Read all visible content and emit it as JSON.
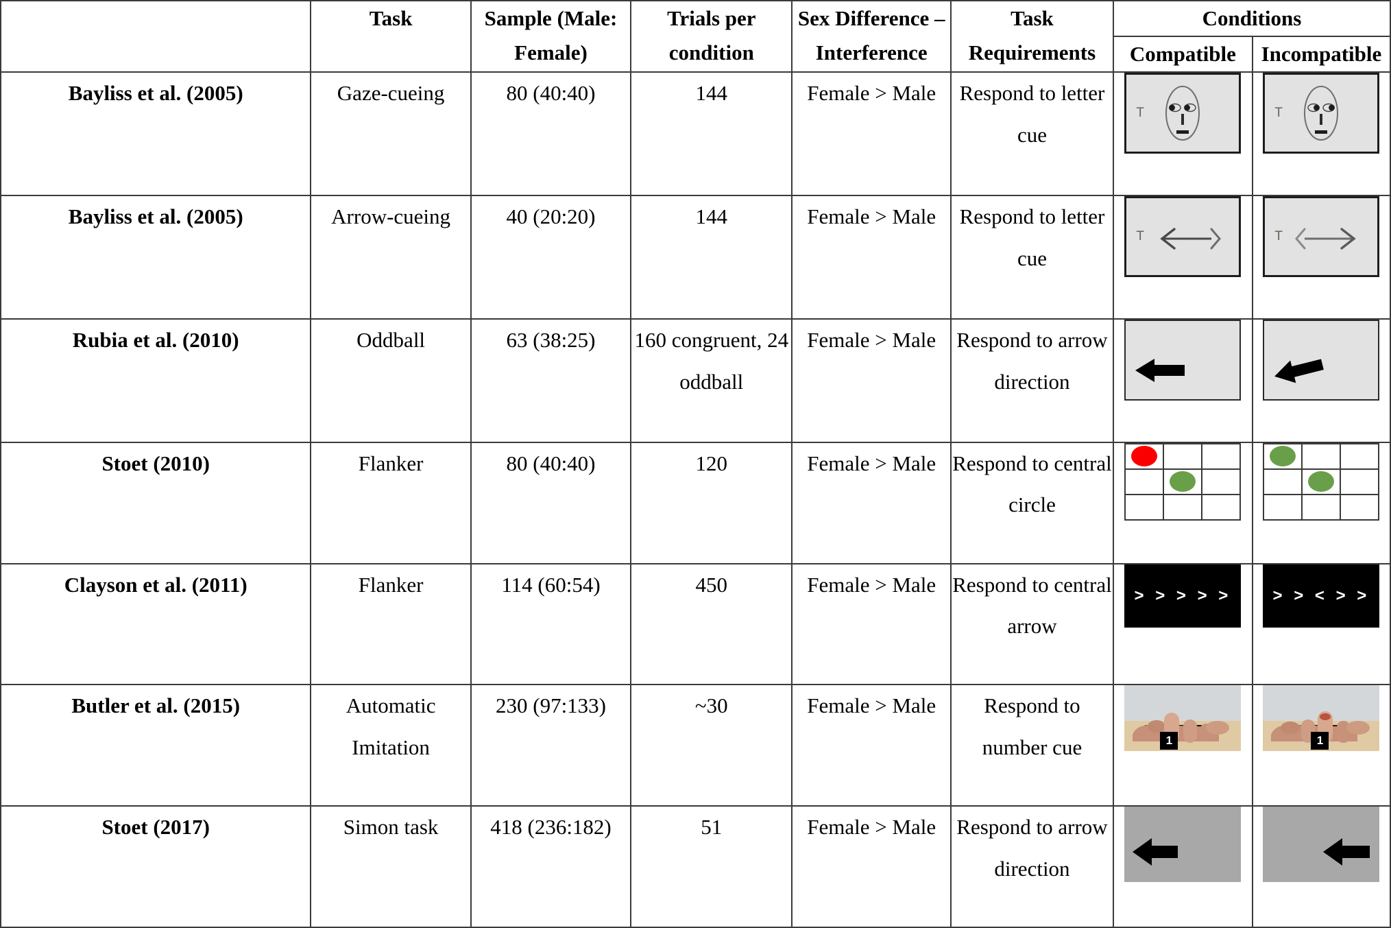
{
  "table": {
    "headers": {
      "corner": "",
      "task": "Task",
      "sample": "Sample (Male: Female)",
      "trials": "Trials per condition",
      "sex_difference": "Sex Difference – Interference",
      "task_requirements": "Task Requirements",
      "conditions": "Conditions",
      "compatible": "Compatible",
      "incompatible": "Incompatible"
    },
    "rows": [
      {
        "study": "Bayliss et al. (2005)",
        "task": "Gaze-cueing",
        "sample": "80 (40:40)",
        "trials": "144",
        "sex_difference": "Female > Male",
        "task_requirements": "Respond to letter cue",
        "stimulus_type": "face-gaze",
        "compatible_desc": "schematic face with eyes gazing left toward letter T cue on grey screen",
        "incompatible_desc": "schematic face with eyes gazing right away from letter T cue on grey screen",
        "cue_letter": "T"
      },
      {
        "study": "Bayliss et al. (2005)",
        "task": "Arrow-cueing",
        "sample": "40 (20:20)",
        "trials": "144",
        "sex_difference": "Female > Male",
        "task_requirements": "Respond to letter cue",
        "stimulus_type": "arrow-cue",
        "compatible_desc": "double-headed arrow pointing left toward letter T cue on grey screen",
        "incompatible_desc": "double-headed arrow pointing right away from letter T cue on grey screen",
        "cue_letter": "T"
      },
      {
        "study": "Rubia et al. (2010)",
        "task": "Oddball",
        "sample": "63 (38:25)",
        "trials": "160 congruent, 24 oddball",
        "sex_difference": "Female > Male",
        "task_requirements": "Respond to arrow direction",
        "stimulus_type": "oddball-arrow",
        "compatible_desc": "horizontal black arrow pointing left on grey screen",
        "incompatible_desc": "tilted black arrow pointing upper-left on grey screen"
      },
      {
        "study": "Stoet (2010)",
        "task": "Flanker",
        "sample": "80 (40:40)",
        "trials": "120",
        "sex_difference": "Female > Male",
        "task_requirements": "Respond to central circle",
        "stimulus_type": "flanker-grid",
        "compatible_desc": "3x3 grid with red circle top-left and green circle in centre",
        "incompatible_desc": "3x3 grid with green circle top-left and green circle in centre",
        "colors": {
          "red": "#fb0000",
          "green": "#6a9f4a"
        }
      },
      {
        "study": "Clayson et al. (2011)",
        "task": "Flanker",
        "sample": "114 (60:54)",
        "trials": "450",
        "sex_difference": "Female > Male",
        "task_requirements": "Respond to central arrow",
        "stimulus_type": "chevron-flanker",
        "compatible_symbols": "> > > > >",
        "incompatible_symbols": "> > < > >",
        "compatible_desc": "five white right-pointing chevrons on black background",
        "incompatible_desc": "white chevrons with central left-pointing chevron on black background"
      },
      {
        "study": "Butler et al. (2015)",
        "task": "Automatic Imitation",
        "sample": "230 (97:133)",
        "trials": "~30",
        "sex_difference": "Female > Male",
        "task_requirements": "Respond to number cue",
        "stimulus_type": "hand-photo",
        "number_cue": "1",
        "compatible_desc": "photograph of a hand lifting the index finger with number cue 1",
        "incompatible_desc": "photograph of a hand lifting the middle finger with number cue 1"
      },
      {
        "study": "Stoet (2017)",
        "task": "Simon task",
        "sample": "418 (236:182)",
        "trials": "51",
        "sex_difference": "Female > Male",
        "task_requirements": "Respond to arrow direction",
        "stimulus_type": "simon-arrow",
        "compatible_desc": "black left-pointing arrow positioned on left side of grey screen",
        "incompatible_desc": "black left-pointing arrow positioned on right side of grey screen"
      }
    ]
  }
}
